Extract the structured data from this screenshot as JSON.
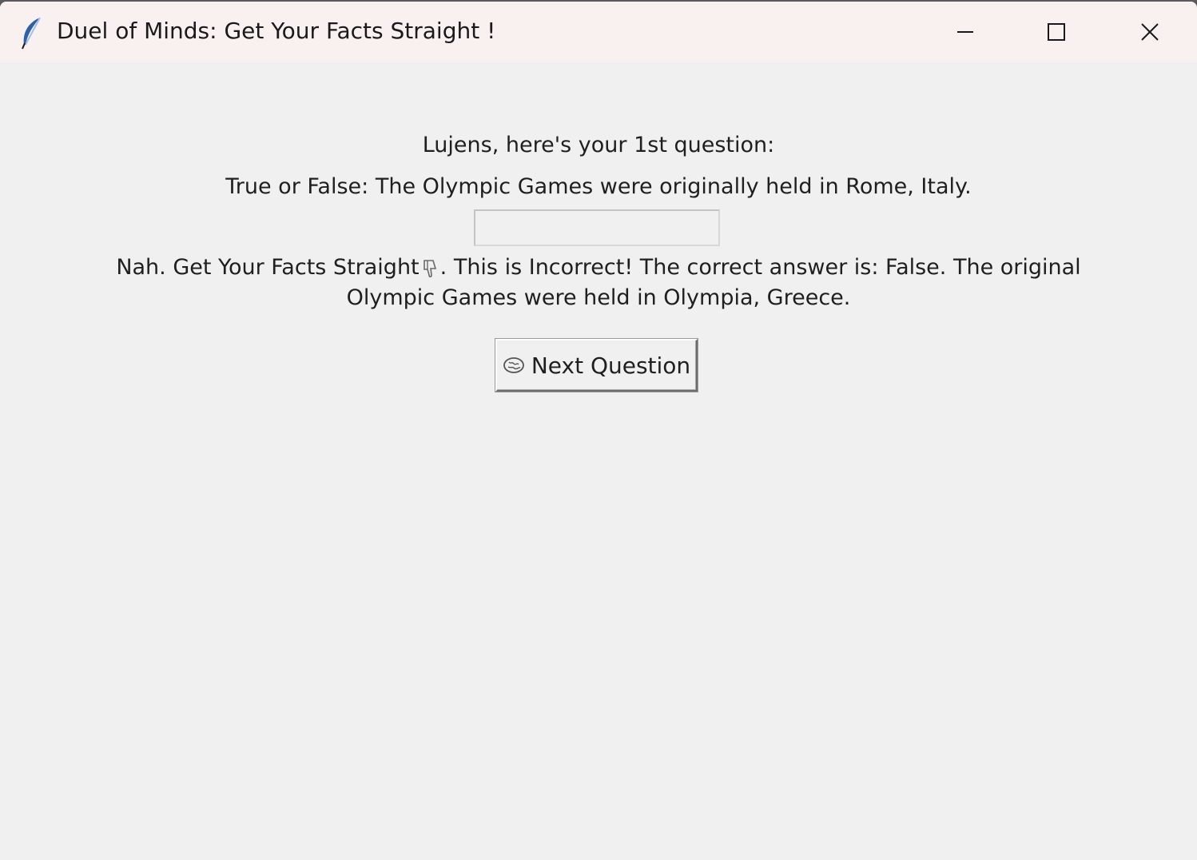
{
  "window": {
    "title": "Duel of Minds: Get Your Facts Straight !"
  },
  "quiz": {
    "greeting": "Lujens, here's your 1st question:",
    "question": "True or False: The Olympic Games were originally held in Rome, Italy.",
    "answer_value": "",
    "feedback_before_icon": "Nah. Get Your Facts Straight",
    "feedback_after_icon": ". This is Incorrect! The correct answer is: False. The original Olympic Games were held in Olympia, Greece.",
    "next_button_label": "Next Question"
  },
  "icons": {
    "app": "feather-icon",
    "feedback": "thumbs-down-icon",
    "next_button": "brain-icon"
  }
}
